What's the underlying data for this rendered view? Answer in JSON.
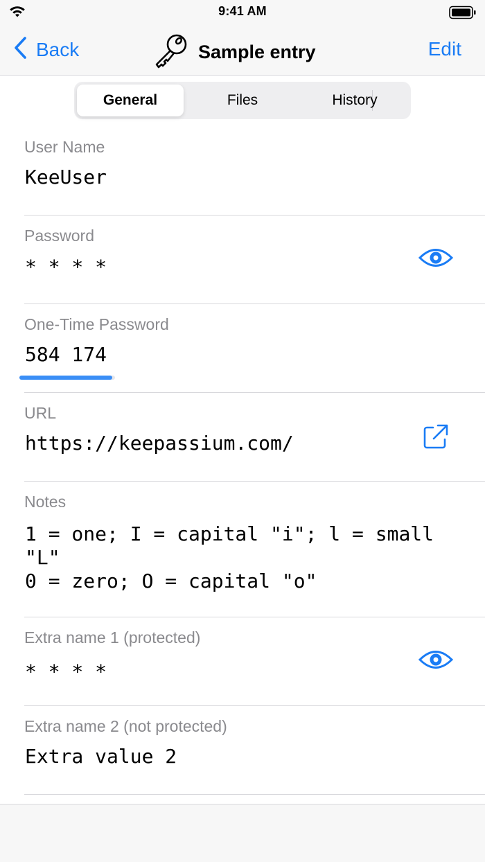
{
  "status_bar": {
    "time": "9:41 AM"
  },
  "nav": {
    "back_label": "Back",
    "title": "Sample entry",
    "edit_label": "Edit"
  },
  "tabs": [
    {
      "label": "General",
      "selected": true
    },
    {
      "label": "Files"
    },
    {
      "label": "History"
    }
  ],
  "fields": {
    "user_name": {
      "label": "User Name",
      "value": "KeeUser"
    },
    "password": {
      "label": "Password",
      "value": "* * * *"
    },
    "otp": {
      "label": "One-Time Password",
      "value": "584 174",
      "time_remaining_fraction": 0.97
    },
    "url": {
      "label": "URL",
      "value": "https://keepassium.com/"
    },
    "notes": {
      "label": "Notes",
      "lines": [
        "1 = one; I = capital \"i\"; l = small \"L\"",
        "0 = zero; O = capital \"o\""
      ]
    },
    "extra1": {
      "label": "Extra name 1 (protected)",
      "value": "* * * *"
    },
    "extra2": {
      "label": "Extra name 2 (not protected)",
      "value": "Extra value 2"
    }
  },
  "colors": {
    "accent": "#1a7cf5",
    "otp_progress": "#3a8ef6",
    "label": "#8a8a8e"
  },
  "icons": {
    "back": "chevron-left-icon",
    "entry": "key-icon",
    "reveal": "eye-icon",
    "open_url": "external-link-icon"
  }
}
